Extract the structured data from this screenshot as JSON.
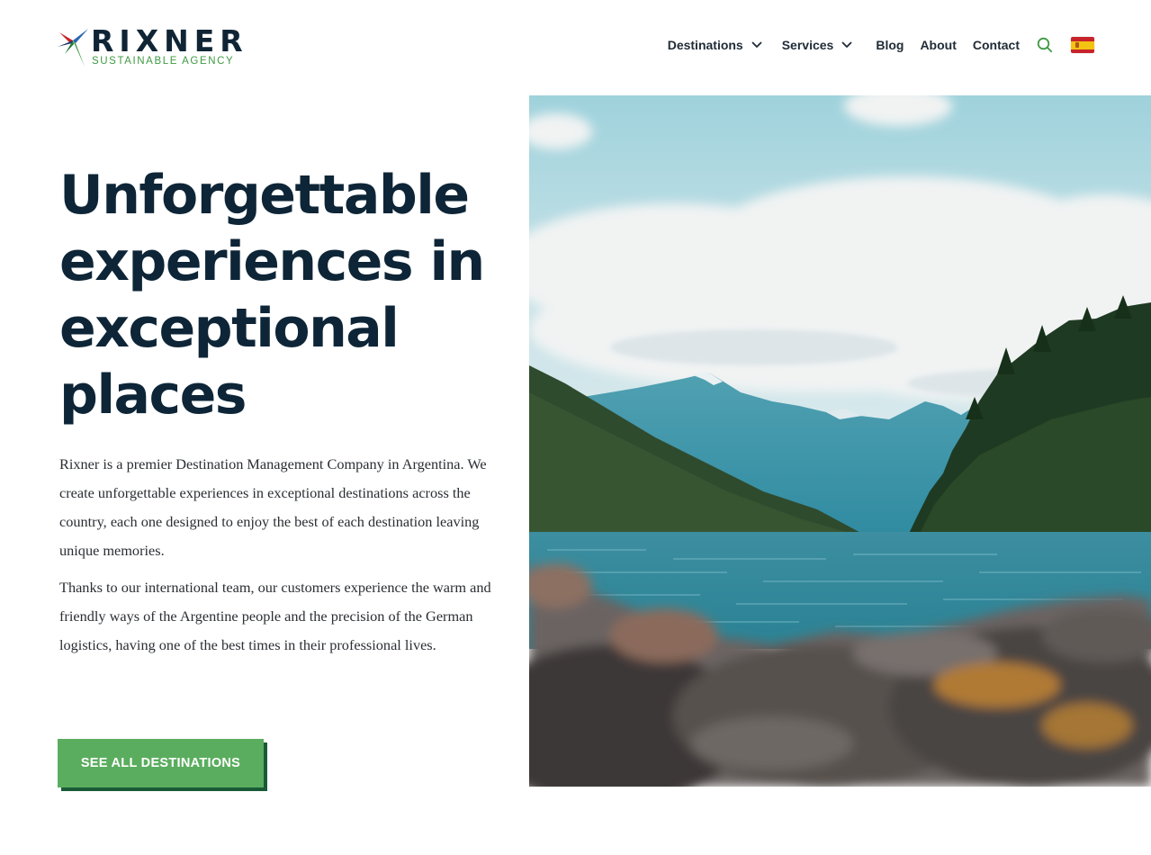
{
  "brand": {
    "name": "RIXNER",
    "tagline": "SUSTAINABLE AGENCY"
  },
  "nav": {
    "destinations": "Destinations",
    "services": "Services",
    "blog": "Blog",
    "about": "About",
    "contact": "Contact",
    "search_icon": "search-icon",
    "language_icon": "spain-flag-icon"
  },
  "hero": {
    "title_lines": [
      "Unforgettable",
      "experiences in",
      "exceptional",
      "places"
    ],
    "paragraphs": [
      "Rixner is a premier Destination Management Company in Argentina. We create unforgettable experiences in exceptional destinations across the country, each one designed to enjoy the best of each destination leaving unique memories.",
      "Thanks to our international team, our customers experience the warm and friendly ways of the Argentine people and the precision of the German logistics, having one of the best times in their professional lives."
    ],
    "cta_label": "SEE ALL DESTINATIONS",
    "image_subject": "mountain lake landscape with forested hills and rocky foreground"
  },
  "colors": {
    "heading": "#0d2537",
    "brand_green": "#3f9a43",
    "cta_green": "#5aad5e",
    "cta_shadow": "#185a36",
    "nav_text": "#1f2b36"
  }
}
